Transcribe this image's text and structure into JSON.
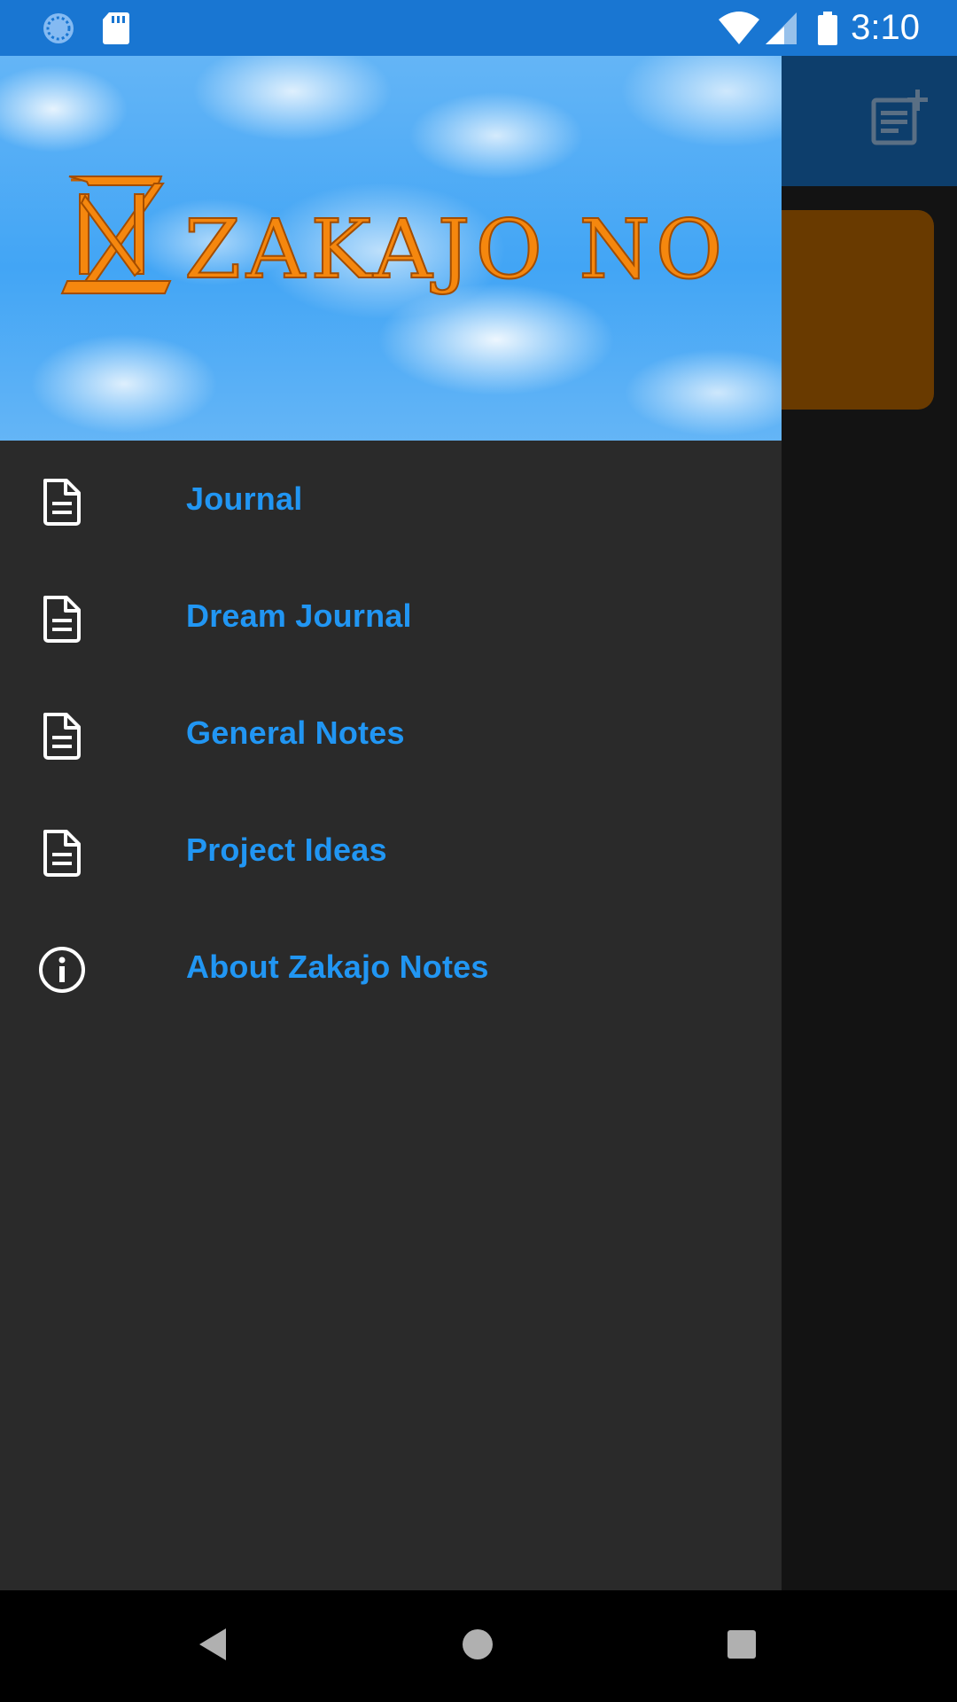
{
  "status_bar": {
    "time": "3:10",
    "icons": [
      "sync-icon",
      "sd-card-icon",
      "wifi-icon",
      "cellular-signal-icon",
      "battery-icon"
    ],
    "background_color": "#1976D2"
  },
  "app": {
    "toolbar_color": "#0d3e6c",
    "toolbar_icon": "add-note-icon",
    "note_card_color": "#693a00"
  },
  "drawer": {
    "header": {
      "logo_text": "ZAKAJO NOTES",
      "logo_color": "#F5870E"
    },
    "items": [
      {
        "label": "Journal",
        "icon": "document-icon"
      },
      {
        "label": "Dream Journal",
        "icon": "document-icon"
      },
      {
        "label": "General Notes",
        "icon": "document-icon"
      },
      {
        "label": "Project Ideas",
        "icon": "document-icon"
      },
      {
        "label": "About Zakajo Notes",
        "icon": "info-icon"
      }
    ],
    "label_color": "#2196F3",
    "background_color": "#2a2a2a"
  },
  "nav_bar": {
    "buttons": [
      "back-icon",
      "home-icon",
      "recents-icon"
    ]
  }
}
